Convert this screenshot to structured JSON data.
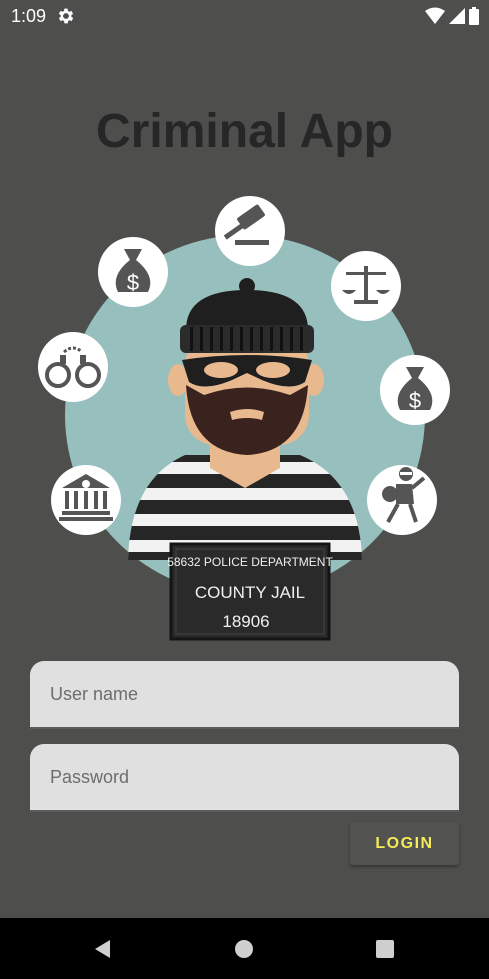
{
  "status_bar": {
    "time": "1:09",
    "icons": [
      "gear-icon",
      "wifi-icon",
      "signal-icon",
      "battery-icon"
    ]
  },
  "app": {
    "title": "Criminal App"
  },
  "illustration": {
    "board_line1": "58632  POLICE DEPARTMENT",
    "board_line2": "COUNTY JAIL",
    "board_line3": "18906",
    "icons": [
      "gavel-icon",
      "money-bag-icon",
      "scales-icon",
      "handcuffs-icon",
      "money-bag-icon",
      "courthouse-icon",
      "thief-running-icon"
    ]
  },
  "form": {
    "username_placeholder": "User name",
    "password_placeholder": "Password",
    "login_label": "LOGIN"
  },
  "colors": {
    "background": "#4e4e4c",
    "title": "#262626",
    "accent": "#f4ec58",
    "field": "#e0e0e0",
    "circle": "#96bfbd"
  },
  "nav_bar": {
    "icons": [
      "back-icon",
      "home-icon",
      "recents-icon"
    ]
  }
}
